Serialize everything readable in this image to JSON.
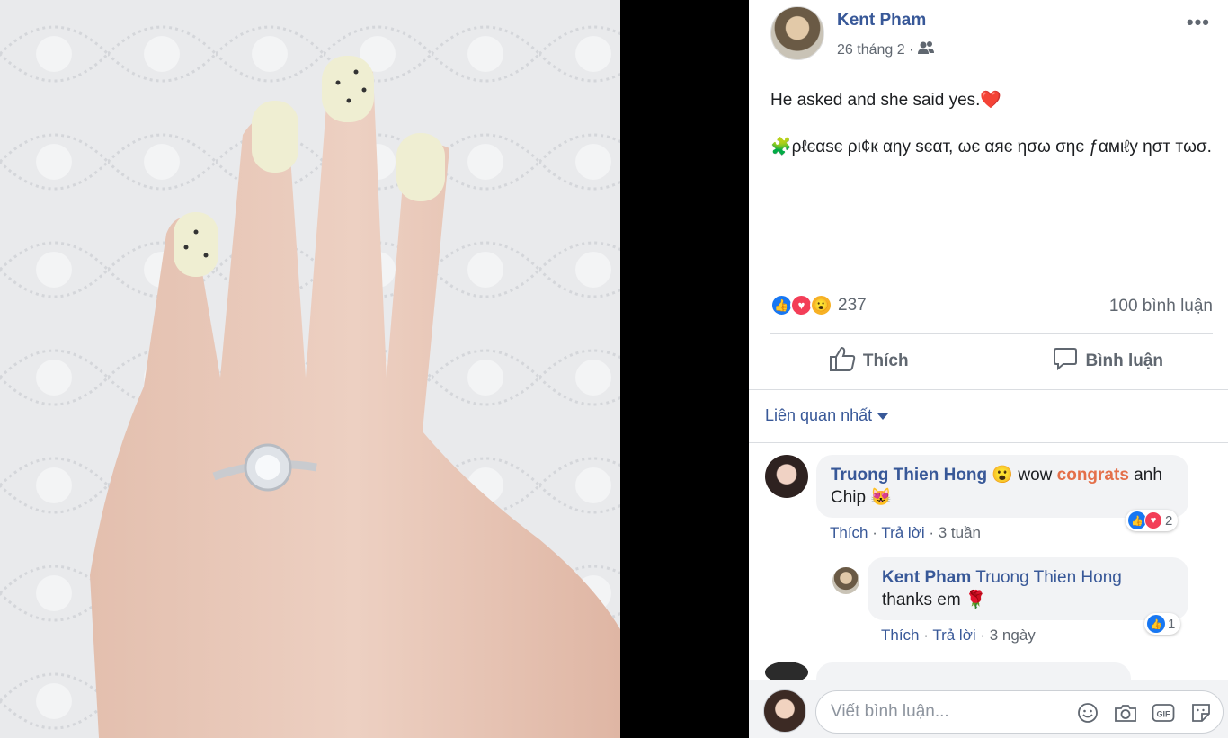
{
  "post": {
    "author": "Kent Pham",
    "date": "26 tháng 2 ·",
    "audience_icon": "friends-icon",
    "line1": "He asked and she said yes.❤️",
    "line2": "🧩ρℓєαѕє ρι¢к αηу ѕєαт, ωє αяє ησω σηє ƒαмιℓу ησт тωσ.",
    "reaction_count": "237",
    "comment_count": "100 bình luận",
    "like_label": "Thích",
    "comment_label": "Bình luận"
  },
  "comments": {
    "sort_label": "Liên quan nhất",
    "items": [
      {
        "name": "Truong Thien Hong",
        "text_a": " 😮 wow ",
        "text_highlight": "congrats",
        "text_b": " anh Chip 😻",
        "like": "Thích",
        "reply": "Trả lời",
        "time": "3 tuần",
        "reaction_count": "2"
      },
      {
        "name": "Kent Pham",
        "mention": "Truong Thien Hong",
        "text": "thanks em 🌹",
        "like": "Thích",
        "reply": "Trả lời",
        "time": "3 ngày",
        "reaction_count": "1"
      }
    ]
  },
  "composer": {
    "placeholder": "Viết bình luận...",
    "icons": [
      "emoji-icon",
      "camera-icon",
      "gif-icon",
      "sticker-icon"
    ]
  }
}
